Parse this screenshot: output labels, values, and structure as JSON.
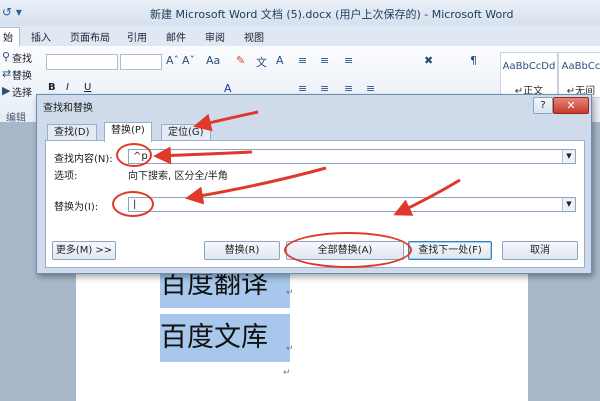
{
  "window": {
    "title": "新建 Microsoft Word 文档 (5).docx (用户上次保存的) - Microsoft Word",
    "quick_access": "↺ ▾"
  },
  "ribbon_tabs": [
    "始",
    "插入",
    "页面布局",
    "引用",
    "邮件",
    "审阅",
    "视图"
  ],
  "ribbon": {
    "find_label": "查找",
    "replace_label": "替换",
    "select_label": "选择",
    "edit_group": "编辑",
    "font_buttons": [
      "B",
      "I",
      "U"
    ],
    "styles": [
      "AaBbCcDd",
      "AaBbCc"
    ],
    "style_names": [
      "↵正文",
      "↵无间"
    ]
  },
  "document": {
    "line1": "百度翻译",
    "line2": "百度文库",
    "para_mark": "↵"
  },
  "dialog": {
    "title": "查找和替换",
    "help": "?",
    "close": "✕",
    "tabs": [
      "查找(D)",
      "替换(P)",
      "定位(G)"
    ],
    "active_tab": 1,
    "find_label": "查找内容(N):",
    "find_value": "^p",
    "options_label": "选项:",
    "options_value": "向下搜索, 区分全/半角",
    "replace_label": "替换为(I):",
    "replace_value": "|",
    "buttons": {
      "more": "更多(M) >>",
      "replace": "替换(R)",
      "replace_all": "全部替换(A)",
      "find_next": "查找下一处(F)",
      "cancel": "取消"
    }
  },
  "annotation_color": "#e0392b"
}
